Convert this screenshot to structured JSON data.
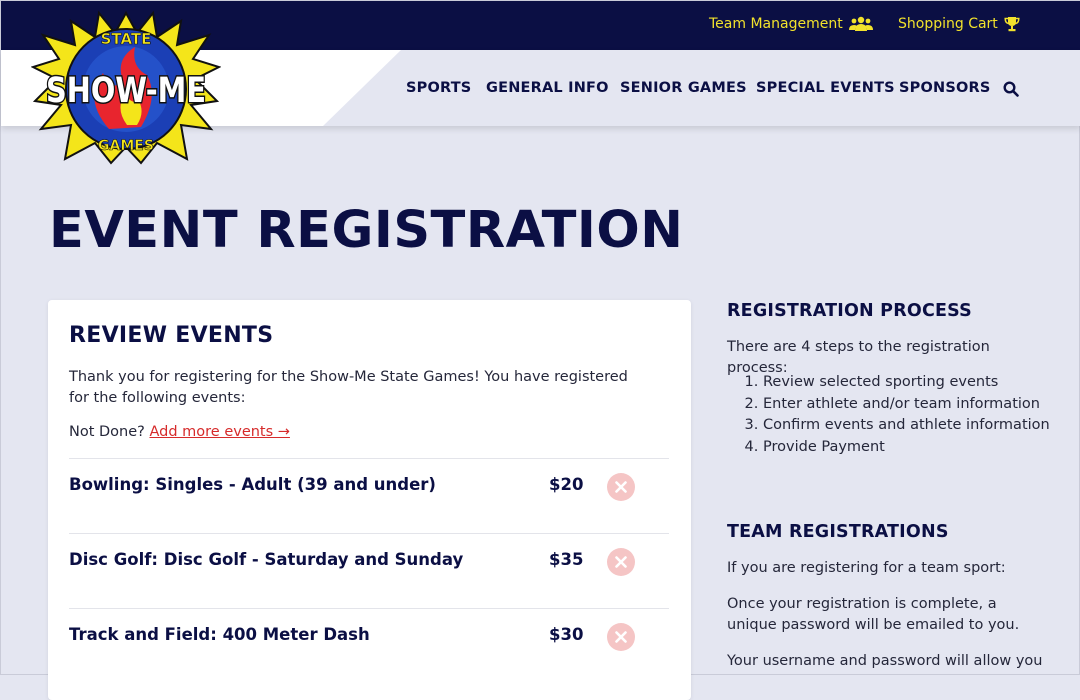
{
  "top_links": {
    "team_management": "Team Management",
    "shopping_cart": "Shopping Cart"
  },
  "icons": {
    "team": "users-icon",
    "cart": "trophy-icon",
    "search": "search-icon",
    "remove": "close-icon"
  },
  "logo": {
    "top": "STATE",
    "middle": "SHOW-ME",
    "bottom": "GAMES"
  },
  "nav": [
    "SPORTS",
    "GENERAL INFO",
    "SENIOR GAMES",
    "SPECIAL EVENTS",
    "SPONSORS"
  ],
  "page_title": "EVENT REGISTRATION",
  "review": {
    "heading": "REVIEW EVENTS",
    "intro": "Thank you for registering for the Show-Me State Games! You have registered for the following events:",
    "not_done": "Not Done?",
    "add_more": "Add more events →",
    "events": [
      {
        "name": "Bowling: Singles - Adult (39 and under)",
        "price": "$20"
      },
      {
        "name": "Disc Golf: Disc Golf - Saturday and Sunday",
        "price": "$35"
      },
      {
        "name": "Track and Field: 400 Meter Dash",
        "price": "$30"
      }
    ]
  },
  "sidebar": {
    "process_heading": "REGISTRATION PROCESS",
    "process_intro": "There are 4 steps to the registration process:",
    "steps": [
      "Review selected sporting events",
      "Enter athlete and/or team information",
      "Confirm events and athlete information",
      "Provide Payment"
    ],
    "team_heading": "TEAM REGISTRATIONS",
    "team_p1": "If you are registering for a team sport:",
    "team_p2": "Once your registration is complete, a unique password will be emailed to you.",
    "team_p3": "Your username and password will allow you"
  },
  "colors": {
    "navy": "#0b0f44",
    "yellow_link": "#f2e22c",
    "background": "#e4e6f1",
    "remove_pink": "#f5c5c5",
    "link_red": "#d62b2b"
  }
}
